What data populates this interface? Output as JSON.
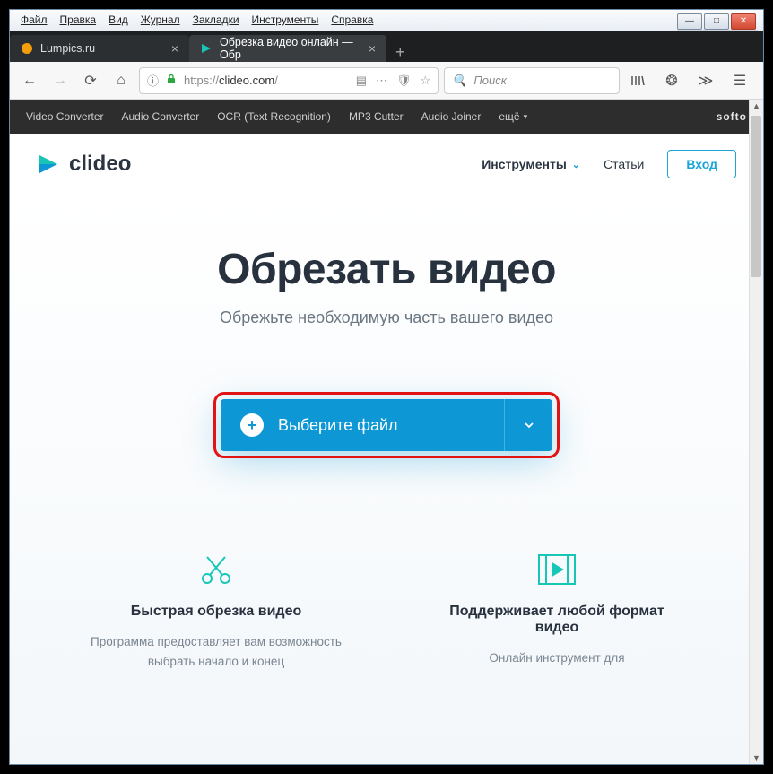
{
  "menubar": [
    "Файл",
    "Правка",
    "Вид",
    "Журнал",
    "Закладки",
    "Инструменты",
    "Справка"
  ],
  "tabs": [
    {
      "title": "Lumpics.ru",
      "active": false,
      "favicon": "orange"
    },
    {
      "title": "Обрезка видео онлайн — Обр",
      "active": true,
      "favicon": "clideo"
    }
  ],
  "url": {
    "scheme": "https",
    "host": "clideo.com",
    "prefix": "https://",
    "info_icon": "ⓘ",
    "lock": true
  },
  "search_placeholder": "Поиск",
  "softo": {
    "links": [
      "Video Converter",
      "Audio Converter",
      "OCR (Text Recognition)",
      "MP3 Cutter",
      "Audio Joiner"
    ],
    "more": "ещё",
    "brand": "softo"
  },
  "clideo": {
    "logo_text": "clideo",
    "tools": "Инструменты",
    "articles": "Статьи",
    "login": "Вход"
  },
  "hero": {
    "title": "Обрезать видео",
    "subtitle": "Обрежьте необходимую часть вашего видео"
  },
  "upload": {
    "label": "Выберите файл"
  },
  "features": [
    {
      "title": "Быстрая обрезка видео",
      "desc": "Программа предоставляет вам возможность выбрать начало и конец"
    },
    {
      "title": "Поддерживает любой формат видео",
      "desc": "Онлайн инструмент для"
    }
  ]
}
